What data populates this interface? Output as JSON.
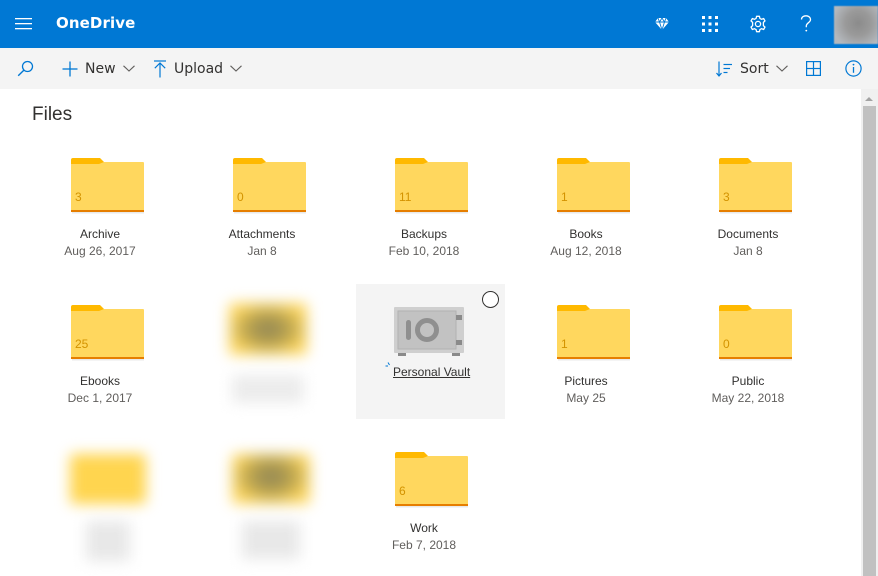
{
  "header": {
    "app_title": "OneDrive",
    "icons": [
      "hamburger-menu-icon",
      "diamond-premium-icon",
      "app-launcher-icon",
      "settings-gear-icon",
      "help-question-icon",
      "user-avatar"
    ]
  },
  "commandbar": {
    "search_icon": "search-icon",
    "new_label": "New",
    "upload_label": "Upload",
    "sort_label": "Sort",
    "view_icon": "grid-view-icon",
    "info_icon": "info-icon"
  },
  "page": {
    "title": "Files"
  },
  "folders": [
    {
      "name": "Archive",
      "date": "Aug 26, 2017",
      "count": "3"
    },
    {
      "name": "Attachments",
      "date": "Jan 8",
      "count": "0"
    },
    {
      "name": "Backups",
      "date": "Feb 10, 2018",
      "count": "11"
    },
    {
      "name": "Books",
      "date": "Aug 12, 2018",
      "count": "1"
    },
    {
      "name": "Documents",
      "date": "Jan 8",
      "count": "3"
    },
    {
      "name": "Ebooks",
      "date": "Dec 1, 2017",
      "count": "25"
    },
    {
      "name": "Pictures",
      "date": "May 25",
      "count": "1"
    },
    {
      "name": "Public",
      "date": "May 22, 2018",
      "count": "0"
    },
    {
      "name": "Work",
      "date": "Feb 7, 2018",
      "count": "6"
    }
  ],
  "vault": {
    "name": "Personal Vault",
    "icon": "safe-vault-icon"
  },
  "colors": {
    "brand": "#0078d4",
    "folder_body": "#ffd75e",
    "folder_tab": "#ffb900",
    "folder_edge": "#e67e00"
  }
}
